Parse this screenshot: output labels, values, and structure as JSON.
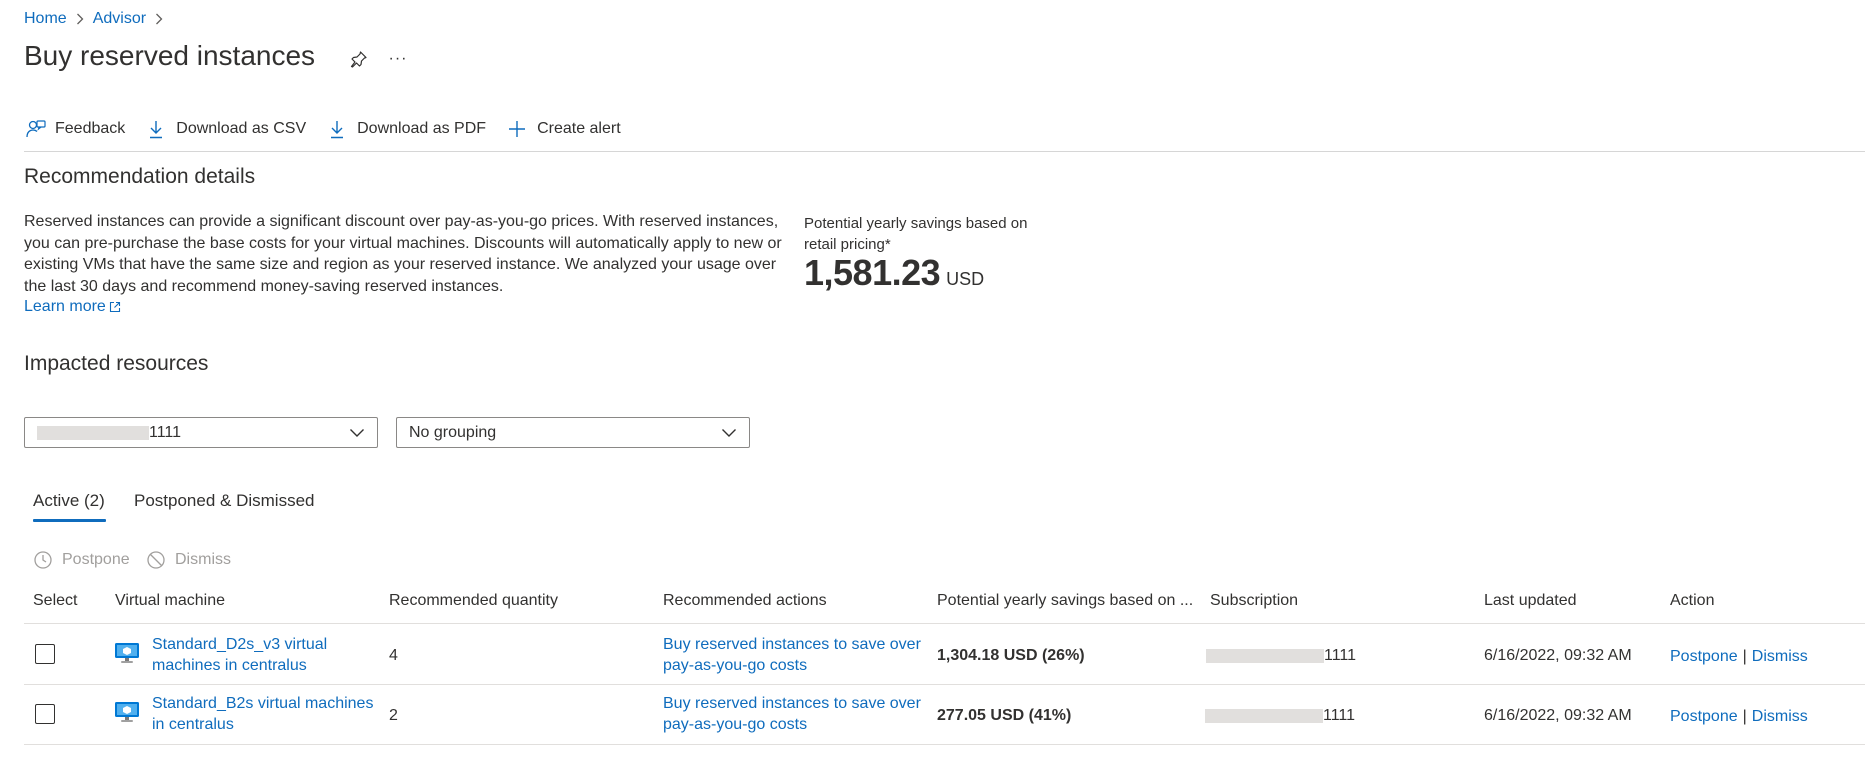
{
  "breadcrumb": {
    "items": [
      "Home",
      "Advisor"
    ]
  },
  "page": {
    "title": "Buy reserved instances",
    "more_label": "···"
  },
  "toolbar": {
    "feedback": "Feedback",
    "download_csv": "Download as CSV",
    "download_pdf": "Download as PDF",
    "create_alert": "Create alert"
  },
  "details": {
    "title": "Recommendation details",
    "description": "Reserved instances can provide a significant discount over pay-as-you-go prices. With reserved instances, you can pre-purchase the base costs for your virtual machines. Discounts will automatically apply to new or existing VMs that have the same size and region as your reserved instance. We analyzed your usage over the last 30 days and recommend money-saving reserved instances.",
    "learn_more": "Learn more",
    "savings_label": "Potential yearly savings based on retail pricing*",
    "savings_value": "1,581.23",
    "savings_unit": "USD"
  },
  "impacted": {
    "title": "Impacted resources",
    "subscription_filter_suffix": "1111",
    "grouping": "No grouping"
  },
  "tabs": [
    {
      "label": "Active (2)",
      "selected": true
    },
    {
      "label": "Postponed & Dismissed",
      "selected": false
    }
  ],
  "actions": {
    "postpone": "Postpone",
    "dismiss": "Dismiss"
  },
  "table": {
    "headers": [
      "Select",
      "Virtual machine",
      "Recommended quantity",
      "Recommended actions",
      "Potential yearly savings based on ...",
      "Subscription",
      "Last updated",
      "Action"
    ],
    "rows": [
      {
        "vm": "Standard_D2s_v3 virtual machines in centralus",
        "quantity": "4",
        "action": "Buy reserved instances to save over pay-as-you-go costs",
        "savings": "1,304.18 USD (26%)",
        "subscription_suffix": "1111",
        "updated": "6/16/2022, 09:32 AM",
        "postpone": "Postpone",
        "dismiss": "Dismiss"
      },
      {
        "vm": "Standard_B2s virtual machines in centralus",
        "quantity": "2",
        "action": "Buy reserved instances to save over pay-as-you-go costs",
        "savings": "277.05 USD (41%)",
        "subscription_suffix": "1111",
        "updated": "6/16/2022, 09:32 AM",
        "postpone": "Postpone",
        "dismiss": "Dismiss"
      }
    ]
  },
  "colors": {
    "accent": "#0f6cbd",
    "text": "#323130",
    "disabled": "#a19f9d",
    "redaction": "#e1dfdd"
  },
  "icons": [
    "chevron-right-icon",
    "pin-icon",
    "more-icon",
    "feedback-icon",
    "download-icon",
    "add-icon",
    "external-link-icon",
    "chevron-down-icon",
    "clock-icon",
    "block-icon",
    "vm-icon"
  ]
}
